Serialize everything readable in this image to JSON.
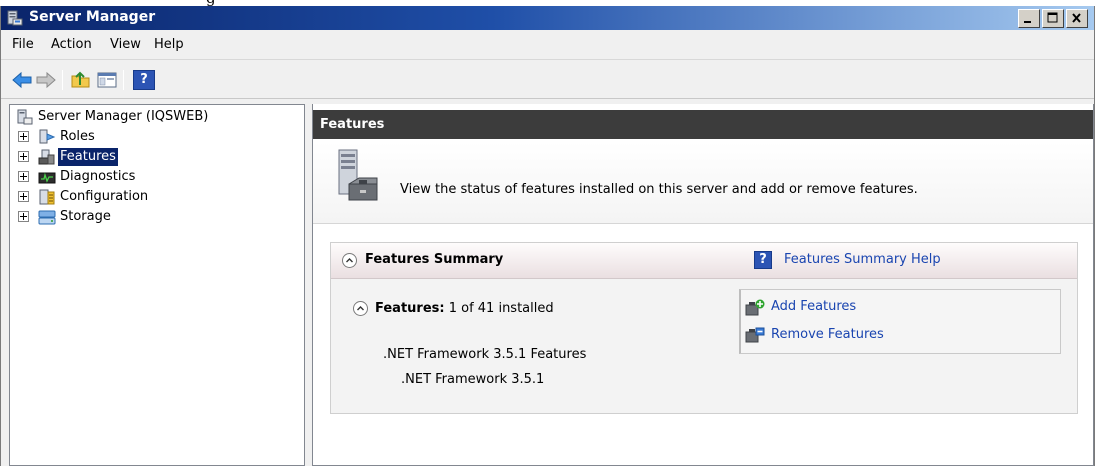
{
  "window": {
    "title": "Server Manager",
    "accent": "#0a246a"
  },
  "menu": [
    "File",
    "Action",
    "View",
    "Help"
  ],
  "toolbar": {
    "buttons": [
      "back-arrow-icon",
      "forward-arrow-icon",
      "up-folder-icon",
      "show-hide-console-tree-icon",
      "help-icon"
    ]
  },
  "tree": {
    "root": "Server Manager (IQSWEB)",
    "items": [
      {
        "label": "Roles"
      },
      {
        "label": "Features",
        "selected": true
      },
      {
        "label": "Diagnostics"
      },
      {
        "label": "Configuration"
      },
      {
        "label": "Storage"
      }
    ]
  },
  "content": {
    "header": "Features",
    "intro": "View the status of features installed on this server and add or remove features.",
    "summary": {
      "title": "Features Summary",
      "help_link": "Features Summary Help",
      "features_label": "Features:",
      "features_count": "1 of 41 installed",
      "installed": [
        ".NET Framework 3.5.1 Features",
        ".NET Framework 3.5.1"
      ],
      "actions": [
        "Add Features",
        "Remove Features"
      ]
    }
  }
}
